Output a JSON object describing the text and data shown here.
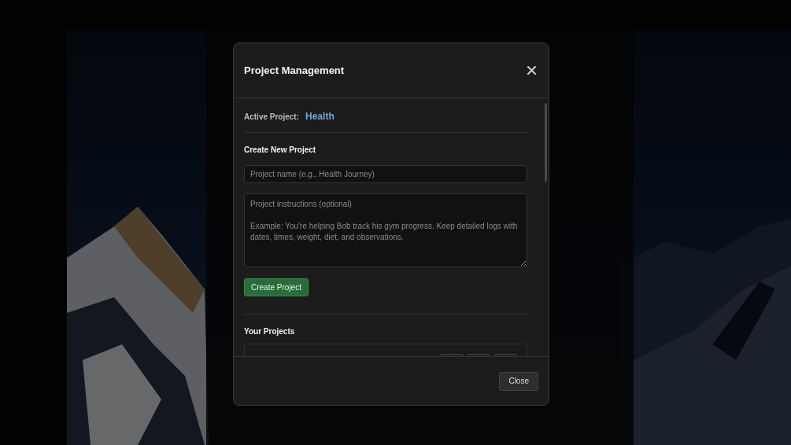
{
  "dialog": {
    "title": "Project Management",
    "active_project": {
      "label": "Active Project:",
      "value": "Health"
    },
    "create": {
      "heading": "Create New Project",
      "name_field": {
        "placeholder": "Project name (e.g., Health Journey)"
      },
      "instructions_field": {
        "placeholder": "Project instructions (optional)\n\nExample: You're helping Bob track his gym progress. Keep detailed logs with dates, times, weight, diet, and observations."
      },
      "button": "Create Project"
    },
    "projects": {
      "heading": "Your Projects"
    },
    "footer": {
      "button": "Close"
    }
  }
}
